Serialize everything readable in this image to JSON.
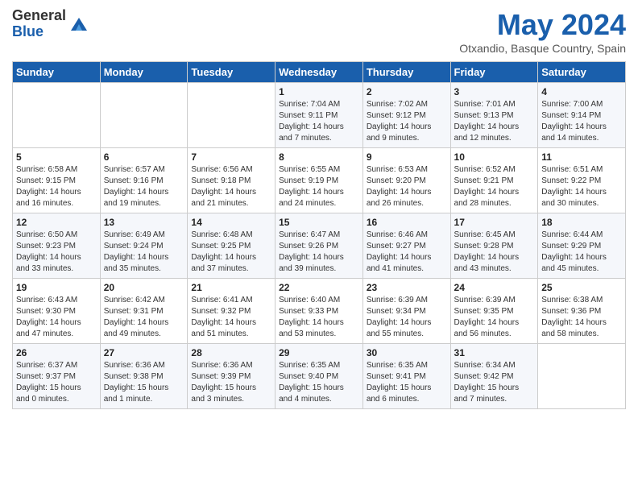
{
  "header": {
    "logo_general": "General",
    "logo_blue": "Blue",
    "title": "May 2024",
    "location": "Otxandio, Basque Country, Spain"
  },
  "days_of_week": [
    "Sunday",
    "Monday",
    "Tuesday",
    "Wednesday",
    "Thursday",
    "Friday",
    "Saturday"
  ],
  "weeks": [
    [
      {
        "day": "",
        "info": ""
      },
      {
        "day": "",
        "info": ""
      },
      {
        "day": "",
        "info": ""
      },
      {
        "day": "1",
        "info": "Sunrise: 7:04 AM\nSunset: 9:11 PM\nDaylight: 14 hours\nand 7 minutes."
      },
      {
        "day": "2",
        "info": "Sunrise: 7:02 AM\nSunset: 9:12 PM\nDaylight: 14 hours\nand 9 minutes."
      },
      {
        "day": "3",
        "info": "Sunrise: 7:01 AM\nSunset: 9:13 PM\nDaylight: 14 hours\nand 12 minutes."
      },
      {
        "day": "4",
        "info": "Sunrise: 7:00 AM\nSunset: 9:14 PM\nDaylight: 14 hours\nand 14 minutes."
      }
    ],
    [
      {
        "day": "5",
        "info": "Sunrise: 6:58 AM\nSunset: 9:15 PM\nDaylight: 14 hours\nand 16 minutes."
      },
      {
        "day": "6",
        "info": "Sunrise: 6:57 AM\nSunset: 9:16 PM\nDaylight: 14 hours\nand 19 minutes."
      },
      {
        "day": "7",
        "info": "Sunrise: 6:56 AM\nSunset: 9:18 PM\nDaylight: 14 hours\nand 21 minutes."
      },
      {
        "day": "8",
        "info": "Sunrise: 6:55 AM\nSunset: 9:19 PM\nDaylight: 14 hours\nand 24 minutes."
      },
      {
        "day": "9",
        "info": "Sunrise: 6:53 AM\nSunset: 9:20 PM\nDaylight: 14 hours\nand 26 minutes."
      },
      {
        "day": "10",
        "info": "Sunrise: 6:52 AM\nSunset: 9:21 PM\nDaylight: 14 hours\nand 28 minutes."
      },
      {
        "day": "11",
        "info": "Sunrise: 6:51 AM\nSunset: 9:22 PM\nDaylight: 14 hours\nand 30 minutes."
      }
    ],
    [
      {
        "day": "12",
        "info": "Sunrise: 6:50 AM\nSunset: 9:23 PM\nDaylight: 14 hours\nand 33 minutes."
      },
      {
        "day": "13",
        "info": "Sunrise: 6:49 AM\nSunset: 9:24 PM\nDaylight: 14 hours\nand 35 minutes."
      },
      {
        "day": "14",
        "info": "Sunrise: 6:48 AM\nSunset: 9:25 PM\nDaylight: 14 hours\nand 37 minutes."
      },
      {
        "day": "15",
        "info": "Sunrise: 6:47 AM\nSunset: 9:26 PM\nDaylight: 14 hours\nand 39 minutes."
      },
      {
        "day": "16",
        "info": "Sunrise: 6:46 AM\nSunset: 9:27 PM\nDaylight: 14 hours\nand 41 minutes."
      },
      {
        "day": "17",
        "info": "Sunrise: 6:45 AM\nSunset: 9:28 PM\nDaylight: 14 hours\nand 43 minutes."
      },
      {
        "day": "18",
        "info": "Sunrise: 6:44 AM\nSunset: 9:29 PM\nDaylight: 14 hours\nand 45 minutes."
      }
    ],
    [
      {
        "day": "19",
        "info": "Sunrise: 6:43 AM\nSunset: 9:30 PM\nDaylight: 14 hours\nand 47 minutes."
      },
      {
        "day": "20",
        "info": "Sunrise: 6:42 AM\nSunset: 9:31 PM\nDaylight: 14 hours\nand 49 minutes."
      },
      {
        "day": "21",
        "info": "Sunrise: 6:41 AM\nSunset: 9:32 PM\nDaylight: 14 hours\nand 51 minutes."
      },
      {
        "day": "22",
        "info": "Sunrise: 6:40 AM\nSunset: 9:33 PM\nDaylight: 14 hours\nand 53 minutes."
      },
      {
        "day": "23",
        "info": "Sunrise: 6:39 AM\nSunset: 9:34 PM\nDaylight: 14 hours\nand 55 minutes."
      },
      {
        "day": "24",
        "info": "Sunrise: 6:39 AM\nSunset: 9:35 PM\nDaylight: 14 hours\nand 56 minutes."
      },
      {
        "day": "25",
        "info": "Sunrise: 6:38 AM\nSunset: 9:36 PM\nDaylight: 14 hours\nand 58 minutes."
      }
    ],
    [
      {
        "day": "26",
        "info": "Sunrise: 6:37 AM\nSunset: 9:37 PM\nDaylight: 15 hours\nand 0 minutes."
      },
      {
        "day": "27",
        "info": "Sunrise: 6:36 AM\nSunset: 9:38 PM\nDaylight: 15 hours\nand 1 minute."
      },
      {
        "day": "28",
        "info": "Sunrise: 6:36 AM\nSunset: 9:39 PM\nDaylight: 15 hours\nand 3 minutes."
      },
      {
        "day": "29",
        "info": "Sunrise: 6:35 AM\nSunset: 9:40 PM\nDaylight: 15 hours\nand 4 minutes."
      },
      {
        "day": "30",
        "info": "Sunrise: 6:35 AM\nSunset: 9:41 PM\nDaylight: 15 hours\nand 6 minutes."
      },
      {
        "day": "31",
        "info": "Sunrise: 6:34 AM\nSunset: 9:42 PM\nDaylight: 15 hours\nand 7 minutes."
      },
      {
        "day": "",
        "info": ""
      }
    ]
  ]
}
